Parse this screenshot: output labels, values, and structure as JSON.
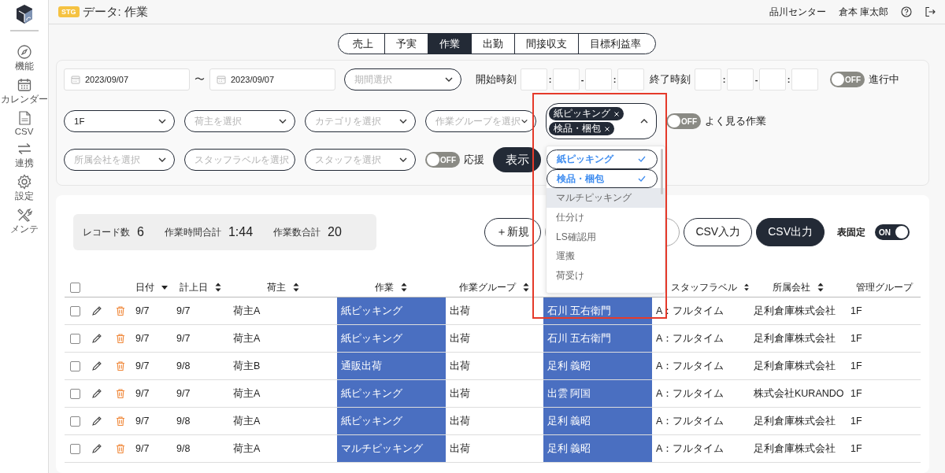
{
  "sidebar": {
    "items": [
      {
        "label": "機能"
      },
      {
        "label": "カレンダー"
      },
      {
        "label": "CSV"
      },
      {
        "label": "連携"
      },
      {
        "label": "設定"
      },
      {
        "label": "メンテ"
      }
    ]
  },
  "header": {
    "env_badge": "STG",
    "title": "データ: 作業",
    "center": "品川センター",
    "user": "倉本 庫太郎"
  },
  "tabs": [
    {
      "label": "売上",
      "selected": false
    },
    {
      "label": "予実",
      "selected": false
    },
    {
      "label": "作業",
      "selected": true
    },
    {
      "label": "出勤",
      "selected": false
    },
    {
      "label": "間接収支",
      "selected": false
    },
    {
      "label": "目標利益率",
      "selected": false
    }
  ],
  "filters": {
    "date_from": "2023/09/07",
    "range_separator": "〜",
    "date_to": "2023/09/07",
    "period": {
      "placeholder": "期間選択"
    },
    "start_time": {
      "label": "開始時刻",
      "separators": [
        ":",
        "-",
        ":"
      ]
    },
    "end_time": {
      "label": "終了時刻",
      "separators": [
        ":",
        "-",
        ":"
      ]
    },
    "in_progress": {
      "label": "進行中",
      "on": false,
      "switch_text": "OFF"
    },
    "row2_selects": [
      {
        "value": "1F"
      },
      {
        "placeholder": "荷主を選択"
      },
      {
        "placeholder": "カテゴリを選択"
      },
      {
        "placeholder": "作業グループを選択"
      }
    ],
    "task": {
      "expanded": true,
      "chips": [
        "紙ピッキング",
        "検品・梱包"
      ],
      "options": [
        {
          "label": "紙ピッキング",
          "selected": true,
          "hovered": false
        },
        {
          "label": "検品・梱包",
          "selected": true,
          "hovered": false
        },
        {
          "label": "マルチピッキング",
          "selected": false,
          "hovered": true
        },
        {
          "label": "仕分け",
          "selected": false,
          "hovered": false
        },
        {
          "label": "LS確認用",
          "selected": false,
          "hovered": false
        },
        {
          "label": "運搬",
          "selected": false,
          "hovered": false
        },
        {
          "label": "荷受け",
          "selected": false,
          "hovered": false
        }
      ]
    },
    "favorites": {
      "label": "よく見る作業",
      "on": false,
      "switch_text": "OFF"
    },
    "row3_selects": [
      {
        "placeholder": "所属会社を選択"
      },
      {
        "placeholder": "スタッフラベルを選択"
      },
      {
        "placeholder": "スタッフを選択"
      }
    ],
    "support": {
      "label": "応援",
      "on": false,
      "switch_text": "OFF"
    },
    "show_button": "表示"
  },
  "results": {
    "summary": [
      {
        "label": "レコード数",
        "value": "6"
      },
      {
        "label": "作業時間合計",
        "value": "1:44"
      },
      {
        "label": "作業数合計",
        "value": "20"
      }
    ],
    "buttons": [
      {
        "kind": "outline",
        "label": "＋新規"
      },
      {
        "kind": "outline"
      },
      {
        "kind": "outline"
      },
      {
        "kind": "outline",
        "label": "CSV入力"
      },
      {
        "kind": "filled",
        "label": "CSV出力"
      }
    ],
    "pin": {
      "label": "表固定",
      "on": true,
      "switch_text": "ON"
    },
    "table": {
      "all_checked": false,
      "columns": [
        {
          "label": "日付",
          "sortable": true,
          "sorted": true,
          "highlighted": false
        },
        {
          "label": "計上日",
          "sortable": true,
          "sorted": false,
          "highlighted": false
        },
        {
          "label": "荷主",
          "sortable": true,
          "sorted": false,
          "highlighted": false
        },
        {
          "label": "作業",
          "sortable": true,
          "sorted": false,
          "highlighted": true
        },
        {
          "label": "作業グループ",
          "sortable": true,
          "sorted": false,
          "highlighted": false
        },
        {
          "highlighted": true
        },
        {
          "label": "スタッフラベル",
          "sortable": true,
          "sorted": false,
          "highlighted": false
        },
        {
          "label": "所属会社",
          "sortable": true,
          "sorted": false,
          "highlighted": false
        },
        {
          "label": "管理グループ",
          "sortable": false,
          "highlighted": false
        }
      ],
      "rows": [
        {
          "checked": false,
          "cells": [
            "9/7",
            "9/7",
            "荷主A",
            "紙ピッキング",
            "出荷",
            "石川 五右衛門",
            "A：フルタイム",
            "足利倉庫株式会社",
            "1F"
          ]
        },
        {
          "checked": false,
          "cells": [
            "9/7",
            "9/7",
            "荷主A",
            "紙ピッキング",
            "出荷",
            "石川 五右衛門",
            "A：フルタイム",
            "足利倉庫株式会社",
            "1F"
          ]
        },
        {
          "checked": false,
          "cells": [
            "9/7",
            "9/8",
            "荷主B",
            "通販出荷",
            "出荷",
            "足利 義昭",
            "A：フルタイム",
            "足利倉庫株式会社",
            "1F"
          ]
        },
        {
          "checked": false,
          "cells": [
            "9/7",
            "9/7",
            "荷主A",
            "紙ピッキング",
            "出荷",
            "出雲 阿国",
            "A：フルタイム",
            "株式会社KURANDO",
            "1F"
          ]
        },
        {
          "checked": false,
          "cells": [
            "9/7",
            "9/8",
            "荷主A",
            "紙ピッキング",
            "出荷",
            "足利 義昭",
            "A：フルタイム",
            "足利倉庫株式会社",
            "1F"
          ]
        },
        {
          "checked": false,
          "cells": [
            "9/7",
            "9/8",
            "荷主A",
            "マルチピッキング",
            "出荷",
            "足利 義昭",
            "A：フルタイム",
            "足利倉庫株式会社",
            "1F"
          ]
        }
      ]
    }
  }
}
